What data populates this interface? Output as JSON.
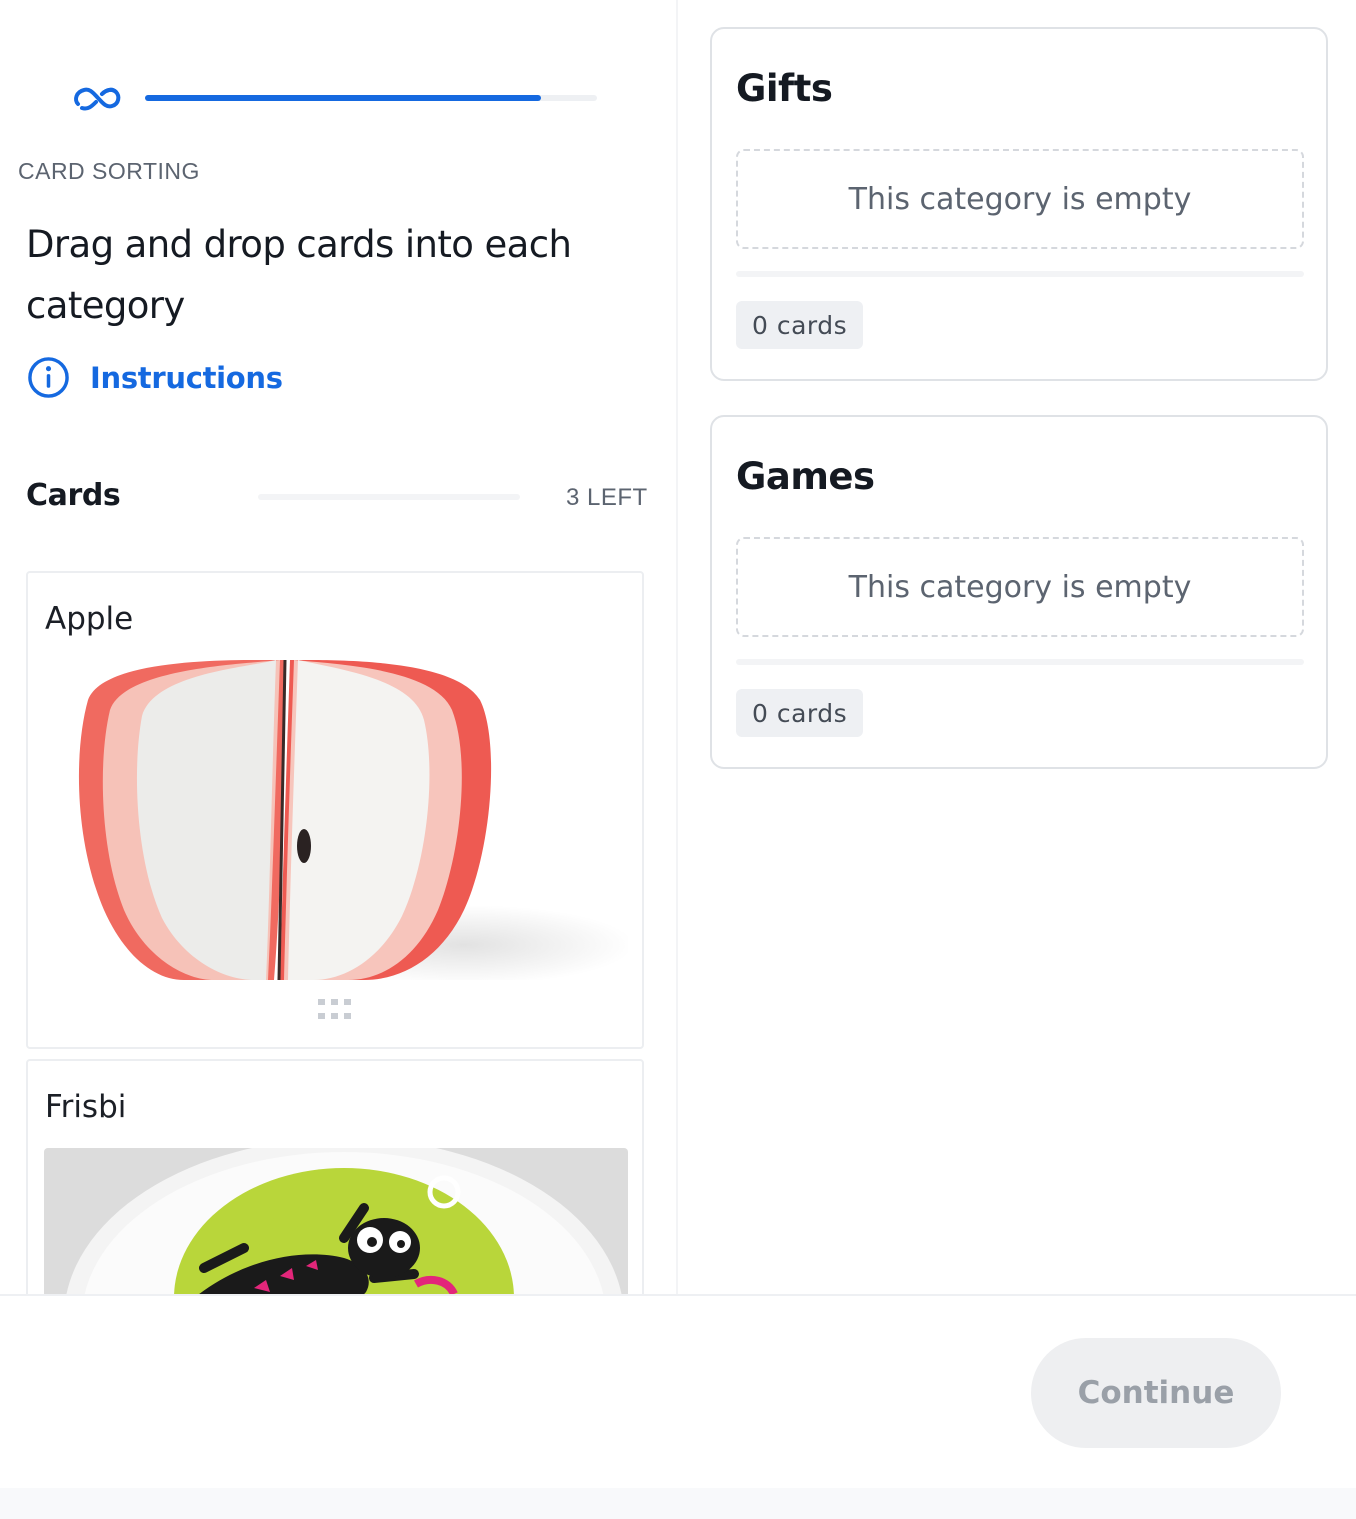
{
  "header": {
    "logo_icon": "brand-logo-icon",
    "progress": 0.876
  },
  "task": {
    "section_label": "CARD SORTING",
    "title": "Drag and drop cards into each category",
    "instructions_label": "Instructions",
    "instructions_icon": "info-icon"
  },
  "cards_panel": {
    "heading": "Cards",
    "remaining": "3 LEFT",
    "cards": [
      {
        "title": "Apple",
        "image": "apple-notepad-photo"
      },
      {
        "title": "Frisbi",
        "image": "frisbee-photo"
      }
    ],
    "drag_icon": "drag-handle-icon"
  },
  "categories": [
    {
      "name": "Gifts",
      "empty_text": "This category is empty",
      "count": "0 cards"
    },
    {
      "name": "Games",
      "empty_text": "This category is empty",
      "count": "0 cards"
    }
  ],
  "footer": {
    "continue_label": "Continue"
  },
  "colors": {
    "accent": "#1569e0",
    "text": "#151a22",
    "muted": "#5c6470",
    "disabled_button": "#eeeff1"
  }
}
